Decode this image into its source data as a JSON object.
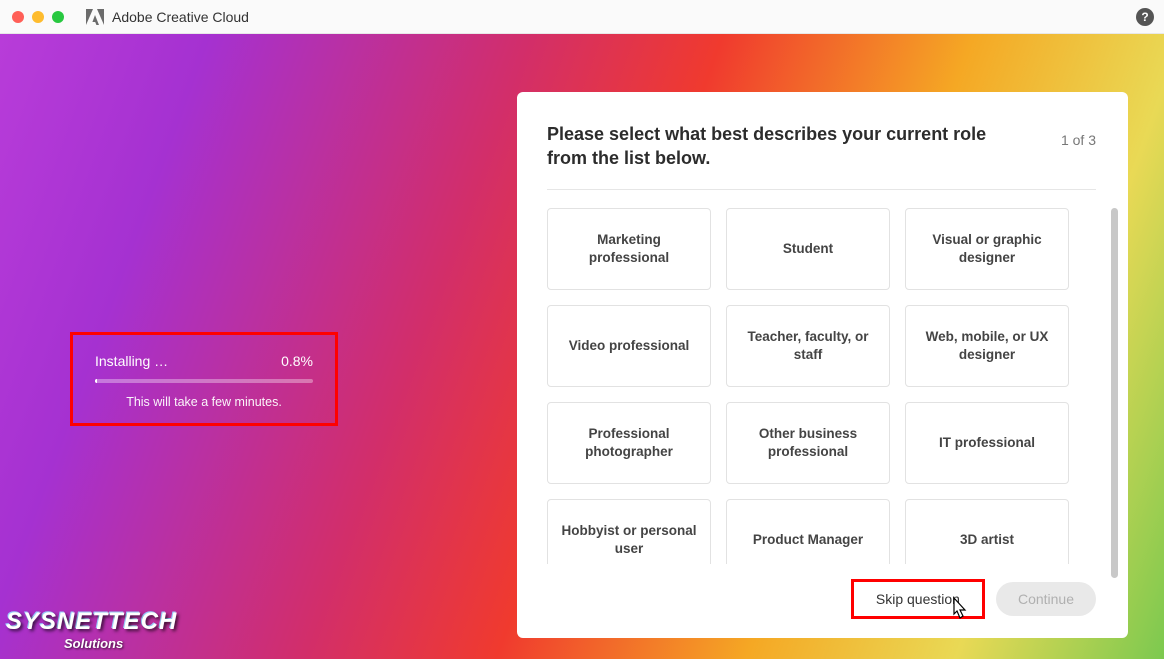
{
  "titlebar": {
    "app_name": "Adobe Creative Cloud"
  },
  "install": {
    "label": "Installing",
    "dots": "…",
    "percent": "0.8%",
    "note": "This will take a few minutes."
  },
  "panel": {
    "prompt": "Please select what best describes your current role from the list below.",
    "step": "1 of 3",
    "options": [
      "Marketing professional",
      "Student",
      "Visual or graphic designer",
      "Video professional",
      "Teacher, faculty, or staff",
      "Web, mobile, or UX designer",
      "Professional photographer",
      "Other business professional",
      "IT professional",
      "Hobbyist or personal user",
      "Product Manager",
      "3D artist"
    ],
    "skip_label": "Skip question",
    "continue_label": "Continue"
  },
  "watermark": {
    "top": "SYSNETTECH",
    "sub": "Solutions"
  }
}
